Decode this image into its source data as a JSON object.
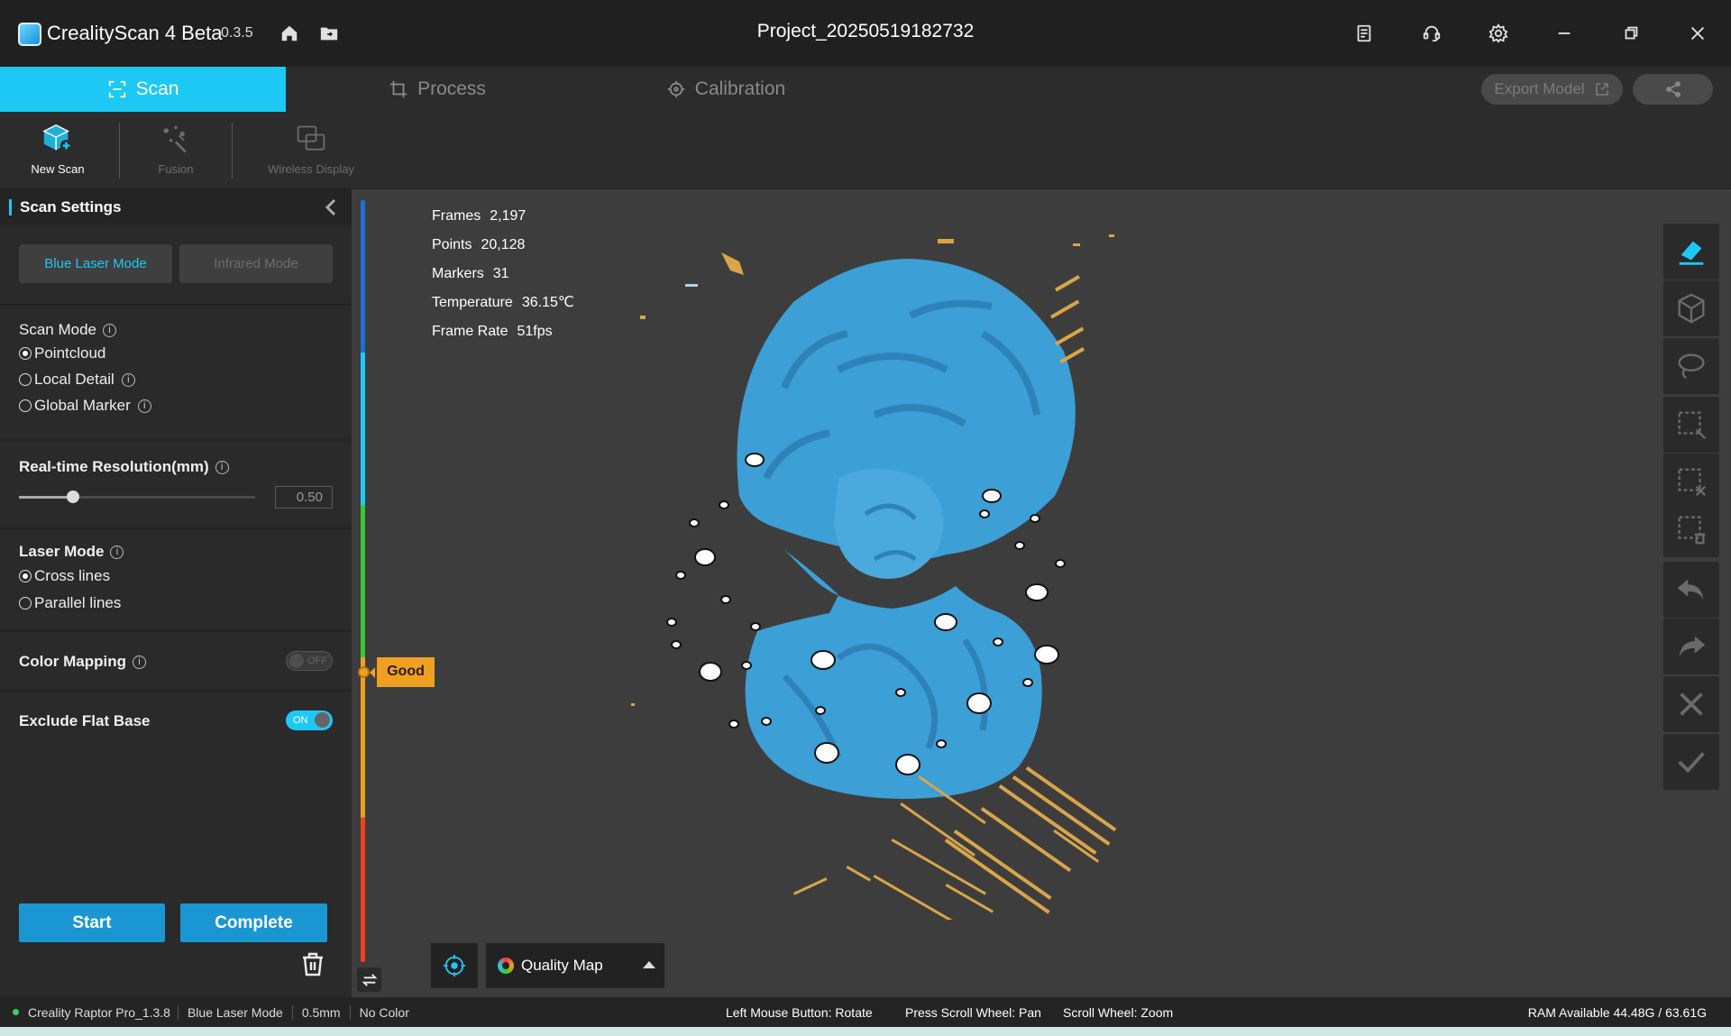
{
  "app": {
    "name": "CrealityScan 4 Beta",
    "version": "0.3.5",
    "project": "Project_20250519182732"
  },
  "titlebar_icons": [
    "home-icon",
    "folder-icon",
    "notes-icon",
    "support-icon",
    "settings-icon",
    "minimize-icon",
    "restore-icon",
    "close-icon"
  ],
  "tabs": [
    {
      "label": "Scan",
      "active": true
    },
    {
      "label": "Process",
      "active": false
    },
    {
      "label": "Calibration",
      "active": false
    }
  ],
  "tab_actions": {
    "export_label": "Export Model"
  },
  "toolbar": [
    {
      "label": "New Scan",
      "active": true
    },
    {
      "label": "Fusion",
      "active": false
    },
    {
      "label": "Wireless Display",
      "active": false
    }
  ],
  "panel": {
    "title": "Scan Settings",
    "modes": [
      {
        "label": "Blue Laser Mode",
        "active": true
      },
      {
        "label": "Infrared Mode",
        "active": false
      }
    ],
    "scan_mode": {
      "title": "Scan Mode",
      "options": [
        {
          "label": "Pointcloud",
          "selected": true
        },
        {
          "label": "Local Detail",
          "selected": false
        },
        {
          "label": "Global Marker",
          "selected": false
        }
      ]
    },
    "resolution": {
      "title": "Real-time Resolution(mm)",
      "value": "0.50",
      "fraction": 0.23
    },
    "laser_mode": {
      "title": "Laser Mode",
      "options": [
        {
          "label": "Cross lines",
          "selected": true
        },
        {
          "label": "Parallel lines",
          "selected": false
        }
      ]
    },
    "color_mapping": {
      "title": "Color Mapping",
      "state": "OFF"
    },
    "exclude_flat_base": {
      "title": "Exclude Flat Base",
      "state": "ON"
    },
    "start_label": "Start",
    "complete_label": "Complete"
  },
  "viewport": {
    "stats": [
      {
        "label": "Frames",
        "value": "2,197"
      },
      {
        "label": "Points",
        "value": "20,128"
      },
      {
        "label": "Markers",
        "value": "31"
      },
      {
        "label": "Temperature",
        "value": "36.15℃"
      },
      {
        "label": "Frame Rate",
        "value": "51fps"
      }
    ],
    "quality_label": "Good",
    "quality_level": 0.62,
    "view_mode": "Quality Map"
  },
  "right_tools": [
    "eraser-icon",
    "cube-icon",
    "lasso-icon",
    "box-select-icon",
    "box-deselect-icon",
    "delete-selection-icon",
    "undo-icon",
    "redo-icon",
    "cancel-icon",
    "confirm-icon"
  ],
  "statusbar": {
    "device": "Creality Raptor Pro_1.3.8",
    "mode": "Blue Laser Mode",
    "resolution": "0.5mm",
    "color": "No Color",
    "hints": [
      "Left Mouse Button: Rotate",
      "Press Scroll Wheel: Pan",
      "Scroll Wheel: Zoom"
    ],
    "ram": "RAM Available 44.48G / 63.61G"
  },
  "colors": {
    "accent": "#1ec8f5",
    "primary_button": "#1a96d3",
    "quality_good": "#f0a020",
    "model_blue": "#3c9fd6"
  }
}
